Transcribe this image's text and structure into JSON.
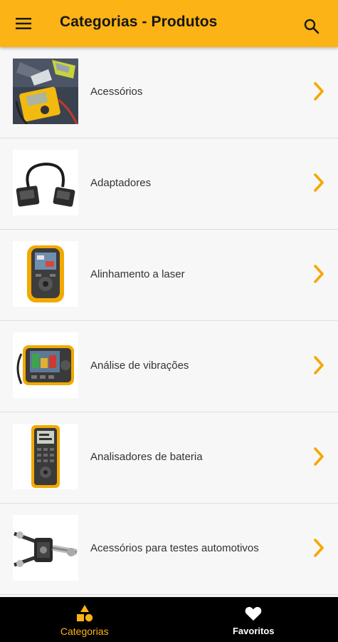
{
  "header": {
    "title": "Categorias - Produtos",
    "menu_icon": "hamburger-menu-icon",
    "search_icon": "search-icon",
    "bg_color": "#fcb315"
  },
  "categories": [
    {
      "label": "Acessórios",
      "image": "multimeter-accessories-image"
    },
    {
      "label": "Adaptadores",
      "image": "serial-cable-adapter-image"
    },
    {
      "label": "Alinhamento a laser",
      "image": "laser-alignment-device-image"
    },
    {
      "label": "Análise de vibrações",
      "image": "vibration-analyzer-image"
    },
    {
      "label": "Analisadores de bateria",
      "image": "battery-analyzer-image"
    },
    {
      "label": "Acessórios para testes automotivos",
      "image": "automotive-test-leads-image"
    }
  ],
  "bottom_nav": {
    "items": [
      {
        "label": "Categorias",
        "icon": "shapes-icon",
        "active": true
      },
      {
        "label": "Favoritos",
        "icon": "heart-icon",
        "active": false
      }
    ],
    "active_color": "#fcb315"
  },
  "chevron_icon": "chevron-right-icon",
  "accent": "#f5a800"
}
